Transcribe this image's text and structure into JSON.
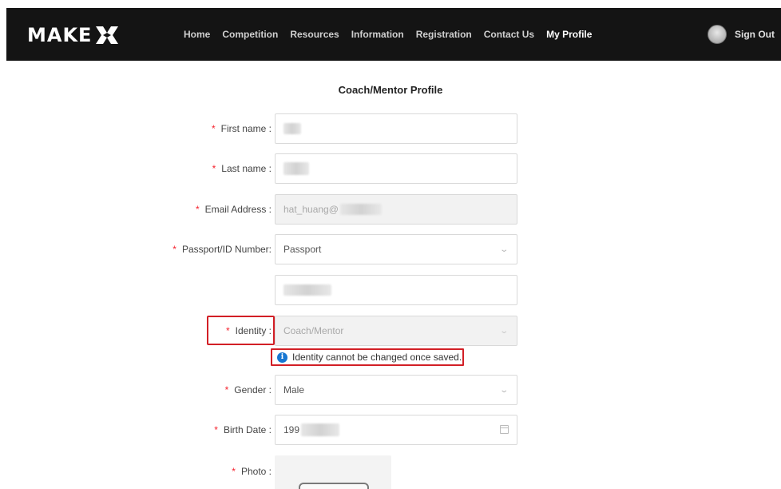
{
  "navbar": {
    "logo_text": "MAKE",
    "links": [
      "Home",
      "Competition",
      "Resources",
      "Information",
      "Registration",
      "Contact Us",
      "My Profile"
    ],
    "active_link": "My Profile",
    "sign_out": "Sign Out"
  },
  "page": {
    "title": "Coach/Mentor Profile"
  },
  "form": {
    "first_name_label": "First name :",
    "last_name_label": "Last name :",
    "email_label": "Email Address :",
    "email_value": "hat_huang@",
    "passport_label": "Passport/ID Number:",
    "passport_type_value": "Passport",
    "identity_label": "Identity :",
    "identity_value": "Coach/Mentor",
    "identity_notice": "Identity cannot be changed once saved.",
    "gender_label": "Gender :",
    "gender_value": "Male",
    "birth_date_label": "Birth Date :",
    "birth_date_value": "199",
    "photo_label": "Photo :",
    "required_mark": "*"
  },
  "colors": {
    "navbar_bg": "#141414",
    "required": "#f5222d",
    "annotation_red": "#d21f26",
    "info_blue": "#1677d2"
  },
  "icons": {
    "info": "info-circle-icon",
    "dropdown": "chevron-down-icon",
    "calendar": "calendar-icon"
  }
}
